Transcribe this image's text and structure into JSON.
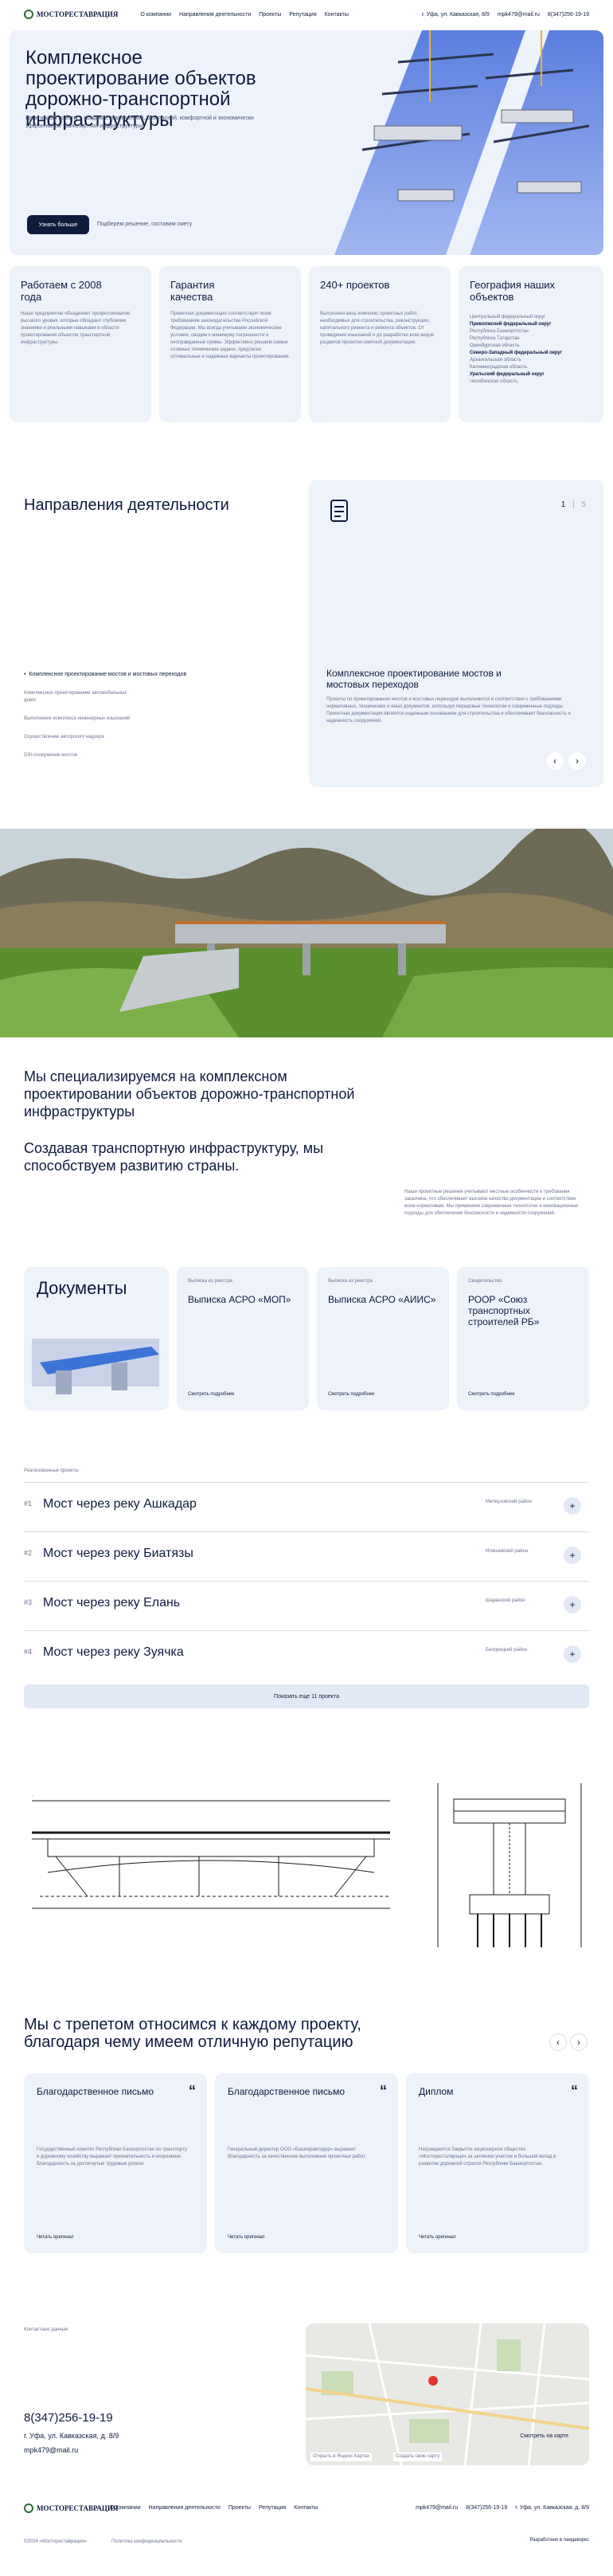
{
  "header": {
    "logo_text": "МОСТОРЕСТАВРАЦИЯ",
    "nav": [
      "О компании",
      "Направления деятельности",
      "Проекты",
      "Репутация",
      "Контакты"
    ],
    "address": "г. Уфа, ул. Кавказская, 8/9",
    "email": "mpk479@mail.ru",
    "phone": "8(347)256-19-19"
  },
  "hero": {
    "title": "Комплексное проектирование объектов дорожно-транспортной инфраструктуры",
    "subtitle": "Цель нашей работы – создание современной, безопасной, комфортной и экономически эффективной транспортной инфраструктуры.",
    "button_label": "Узнать больше",
    "button_hint": "Подберем решение, составим смету"
  },
  "stats": [
    {
      "title": "Работаем с 2008 года",
      "text": "Наше предприятие объединяет профессионалов высокого уровня, которые обладают глубокими знаниями и реальными навыками в области проектирования объектов транспортной инфраструктуры."
    },
    {
      "title": "Гарантия качества",
      "text": "Проектная документация соответствует всем требованиям законодательства Российской Федерации. Мы всегда учитываем экономические условия, сводим к минимуму погрешности и неоправданные суммы. Эффективно решаем самые сложные технические задачи, предлагая оптимальные и надежные варианты проектирования."
    },
    {
      "title": "240+ проектов",
      "text": "Выполнено весь комплекс проектных работ, необходимых для строительства, реконструкции, капитального ремонта и ремонта объектов. От проведения изысканий и до разработки всех видов разделов проектно-сметной документации."
    },
    {
      "title": "География наших объектов",
      "list": [
        "Центральный федеральный округ",
        "Приволжский федеральный округ",
        "Республика Башкортостан",
        "Республика Татарстан",
        "Оренбургская область",
        "Северо-Западный федеральный округ",
        "Архангельская область",
        "Калининградская область",
        "Уральский федеральный округ",
        "Челябинская область"
      ]
    }
  ],
  "directions": {
    "title": "Направления деятельности",
    "list": [
      "Комплексное проектирование мостов и мостовых переходов",
      "Комплексное проектирование автомобильных дорог",
      "Выполнение комплекса инженерных изысканий",
      "Осуществление авторского надзора",
      "DSI-сооружение мостов"
    ],
    "counter_current": "1",
    "counter_total": "5",
    "active_title": "Комплексное проектирование мостов и мостовых переходов",
    "active_text": "Проекты по проектированию мостов и мостовых переходов выполняются в соответствии с требованиями нормативных, технических и иных документов, используя передовые технологии и современные подходы. Проектная документация является надежным основанием для строительства и обеспечивает безопасность и надежность сооружений."
  },
  "about": {
    "title": "Мы специализируемся на комплексном проектировании объектов дорожно-транспортной инфраструктуры",
    "title2": "Создавая транспортную инфраструктуру, мы способствуем развитию страны.",
    "text": "Наши проектные решения учитывают местные особенности и требования заказчика, что обеспечивает высокое качество документации и соответствие всем нормативам. Мы применяем современные технологии и инновационные подходы для обеспечения безопасности и надежности сооружений."
  },
  "documents": {
    "title": "Документы",
    "cards": [
      {
        "tag": "Выписка из реестра",
        "title": "Выписка АСРО «МОП»",
        "link": "Смотреть подробнее"
      },
      {
        "tag": "Выписка из реестра",
        "title": "Выписка АСРО «АИИС»",
        "link": "Смотреть подробнее"
      },
      {
        "tag": "Свидетельство",
        "title": "РООР «Союз транспортных строителей РБ»",
        "link": "Смотреть подробнее"
      }
    ]
  },
  "projects": {
    "label": "Реализованные проекты",
    "items": [
      {
        "num": "#1",
        "title": "Мост через реку Ашкадар",
        "region": "Мелеузовский район"
      },
      {
        "num": "#2",
        "title": "Мост через реку Биатязы",
        "region": "Илишевский район"
      },
      {
        "num": "#3",
        "title": "Мост через реку Елань",
        "region": "Шаранский район"
      },
      {
        "num": "#4",
        "title": "Мост через реку Зуячка",
        "region": "Белорецкий район"
      }
    ],
    "more_button": "Показать еще 11 проекта"
  },
  "reputation": {
    "title": "Мы с трепетом относимся к каждому проекту, благодаря чему имеем отличную репутацию",
    "cards": [
      {
        "title": "Благодарственное письмо",
        "text": "Государственный комитет Республики Башкортостан по транспорту и дорожному хозяйству выражает признательность и искреннюю благодарность за достигнутые трудовые успехи.",
        "link": "Читать оригинал"
      },
      {
        "title": "Благодарственное письмо",
        "text": "Генеральный директор ООО «Башкиравтодор» выражает благодарность за качественное выполнение проектных работ.",
        "link": "Читать оригинал"
      },
      {
        "title": "Диплом",
        "text": "Награждается Закрытое акционерное общество «Мосторесталвраця» за активное участие и большой вклад в развитие дорожной отрасли Республики Башкортостан.",
        "link": "Читать оригинал"
      }
    ]
  },
  "contacts": {
    "label": "Контактные данные",
    "phone": "8(347)256-19-19",
    "address": "г. Уфа, ул. Кавказская, д. 8/9",
    "email": "mpk479@mail.ru",
    "map_link": "Смотреть на карте",
    "map_label": "Открыть в Яндекс Картах",
    "map_route": "Создать свою карту"
  },
  "footer": {
    "nav": [
      "О компании",
      "Направления деятельности",
      "Проекты",
      "Репутация",
      "Контакты"
    ],
    "email": "mpk479@mail.ru",
    "phone": "8(347)256-19-19",
    "address": "г. Уфа, ул. Кавказская, д. 8/9",
    "copyright": "©2024 «Мостореставрация»",
    "policy": "Политика конфиденциальности",
    "dev": "Разработано в пандаворкс"
  },
  "colors": {
    "navy": "#0f1b3d",
    "card": "#eef2f9",
    "accent_blue": "#3b57c8"
  }
}
